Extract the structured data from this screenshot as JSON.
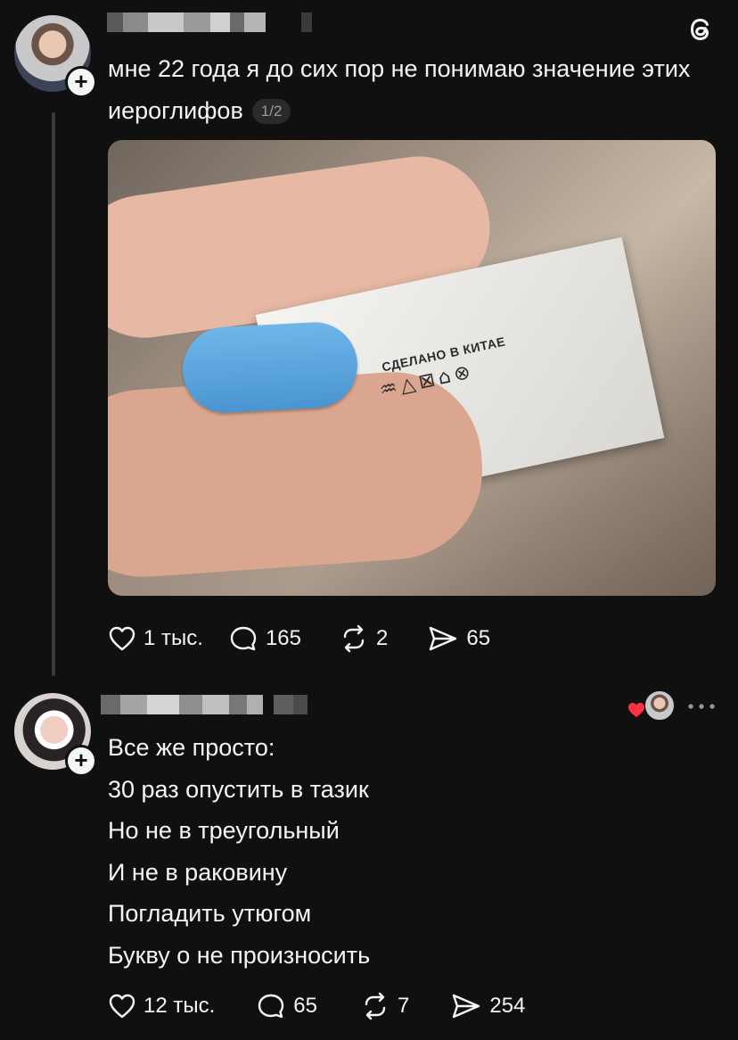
{
  "app": {
    "name": "Threads"
  },
  "post": {
    "text": "мне 22 года я до сих пор не понимаю значение этих иероглифов",
    "page_indicator": "1/2",
    "image_label_text": "СДЕЛАНО В КИТАЕ",
    "image_symbols": "♒△⊠⌂⊗",
    "stats": {
      "likes": "1 тыс.",
      "comments": "165",
      "reposts": "2",
      "shares": "65"
    }
  },
  "reply": {
    "lines": [
      "Все же просто:",
      "30 раз опустить в тазик",
      "Но не в треугольный",
      "И не в раковину",
      "Погладить утюгом",
      "Букву о не произносить"
    ],
    "stats": {
      "likes": "12 тыс.",
      "comments": "65",
      "reposts": "7",
      "shares": "254"
    }
  },
  "icons": {
    "logo": "threads-logo-icon",
    "like": "heart-icon",
    "comment": "comment-bubble-icon",
    "repost": "repost-icon",
    "share": "send-icon",
    "more": "more-dots-icon",
    "follow": "plus-icon"
  },
  "colors": {
    "background": "#101010",
    "text": "#f3f5f7",
    "heart": "#ff3040"
  }
}
